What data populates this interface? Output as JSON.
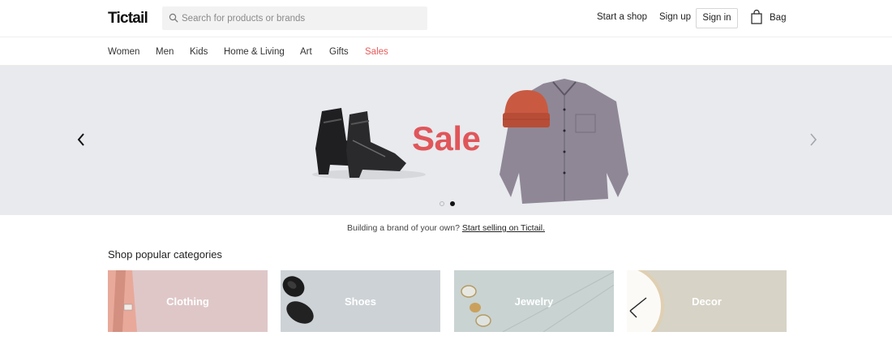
{
  "header": {
    "logo": "Tictail",
    "search": {
      "placeholder": "Search for products or brands",
      "value": ""
    },
    "start_shop": "Start a shop",
    "sign_up": "Sign up",
    "sign_in": "Sign in",
    "bag": "Bag"
  },
  "categories_nav": [
    "Women",
    "Men",
    "Kids",
    "Home & Living",
    "Art",
    "Gifts",
    "Sales"
  ],
  "hero": {
    "headline": "Sale",
    "accent_color": "#e0565a",
    "slide_count": 2,
    "active_slide": 2
  },
  "promo": {
    "text": "Building a brand of your own?",
    "link": "Start selling on Tictail."
  },
  "popular": {
    "title": "Shop popular categories",
    "tiles": [
      "Clothing",
      "Shoes",
      "Jewelry",
      "Decor"
    ]
  }
}
